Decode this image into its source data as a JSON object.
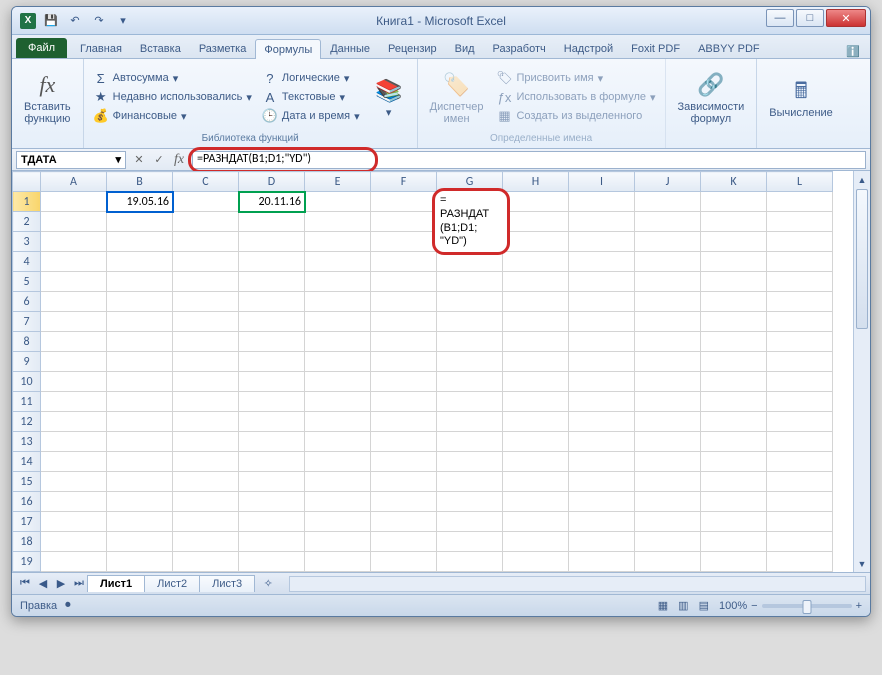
{
  "title": "Книга1 - Microsoft Excel",
  "tabs": [
    "Главная",
    "Вставка",
    "Разметка",
    "Формулы",
    "Данные",
    "Рецензир",
    "Вид",
    "Разработч",
    "Надстрой",
    "Foxit PDF",
    "ABBYY PDF"
  ],
  "activeTab": 3,
  "file": "Файл",
  "ribbon": {
    "insertFn": {
      "label": "Вставить\nфункцию"
    },
    "lib": {
      "autosum": "Автосумма",
      "recent": "Недавно использовались",
      "financial": "Финансовые",
      "logical": "Логические",
      "text": "Текстовые",
      "datetime": "Дата и время",
      "label": "Библиотека функций"
    },
    "names": {
      "manager": "Диспетчер\nимен",
      "assign": "Присвоить имя",
      "useInFormula": "Использовать в формуле",
      "createFromSel": "Создать из выделенного",
      "label": "Определенные имена"
    },
    "deps": "Зависимости\nформул",
    "calc": "Вычисление"
  },
  "nameBox": "ТДАТА",
  "formula": "=РАЗНДАТ(B1;D1;\"YD\")",
  "cells": {
    "B1": "19.05.16",
    "D1": "20.11.16"
  },
  "editOverlay": [
    "=",
    "РАЗНДАТ",
    "(B1;D1;",
    "\"YD\")"
  ],
  "sheets": [
    "Лист1",
    "Лист2",
    "Лист3"
  ],
  "activeSheet": 0,
  "status": "Правка",
  "zoom": "100%",
  "cols": [
    "A",
    "B",
    "C",
    "D",
    "E",
    "F",
    "G",
    "H",
    "I",
    "J",
    "K",
    "L"
  ],
  "rows": 19
}
